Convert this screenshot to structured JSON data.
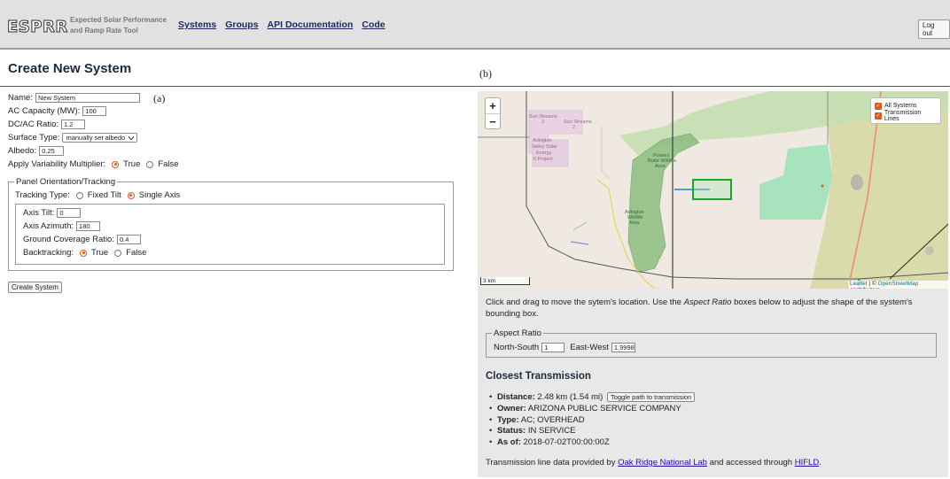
{
  "header": {
    "logo": "ESPRR",
    "tagline_line1": "Expected Solar Performance",
    "tagline_line2": "and Ramp Rate Tool",
    "nav": [
      "Systems",
      "Groups",
      "API Documentation",
      "Code"
    ],
    "logout": "Log out"
  },
  "page_title": "Create New System",
  "panel_labels": {
    "a": "(a)",
    "b": "(b)"
  },
  "form": {
    "name_label": "Name:",
    "name_value": "New System",
    "ac_label": "AC Capacity (MW):",
    "ac_value": "100",
    "dcac_label": "DC/AC Ratio:",
    "dcac_value": "1.2",
    "surface_label": "Surface Type:",
    "surface_value": "manually set albedo",
    "albedo_label": "Albedo:",
    "albedo_value": "0.25",
    "variability_label": "Apply Variability Multiplier:",
    "variability_true": "True",
    "variability_false": "False",
    "variability_selected": "True",
    "panel_legend": "Panel Orientation/Tracking",
    "tracking_label": "Tracking Type:",
    "tracking_fixed": "Fixed Tilt",
    "tracking_single": "Single Axis",
    "tracking_selected": "Single Axis",
    "axis_tilt_label": "Axis Tilt:",
    "axis_tilt_value": "0",
    "axis_azimuth_label": "Axis Azimuth:",
    "axis_azimuth_value": "180",
    "gcr_label": "Ground Coverage Ratio:",
    "gcr_value": "0.4",
    "backtracking_label": "Backtracking:",
    "backtracking_true": "True",
    "backtracking_false": "False",
    "backtracking_selected": "True",
    "create_button": "Create System"
  },
  "map": {
    "zoom_in": "+",
    "zoom_out": "−",
    "layers": [
      "All Systems",
      "Transmission Lines"
    ],
    "scale": "3 km",
    "attribution_leaflet": "Leaflet",
    "attribution_sep": " | © ",
    "attribution_osm": "OpenStreetMap",
    "attribution_tail": " contributors",
    "labels": {
      "sun_streams_3": [
        "Sun Streams",
        "3"
      ],
      "sun_streams_2": [
        "Sun Streams",
        "2"
      ],
      "arlington_valley": [
        "Arlington",
        "Valley Solar",
        "Energy",
        "II Project"
      ],
      "powers_butte": [
        "Powers",
        "Butte Wildlife",
        "Area"
      ],
      "arlington_wildlife": [
        "Arlington",
        "Wildlife",
        "Area"
      ]
    }
  },
  "instructions": {
    "part1": "Click and drag to move the sytem's location. Use the ",
    "italic": "Aspect Ratio",
    "part2": " boxes below to adjust the shape of the system's bounding box."
  },
  "aspect_ratio": {
    "legend": "Aspect Ratio",
    "ns_label": "North-South",
    "ns_value": "1",
    "ew_label": "East-West",
    "ew_value": "1.9998"
  },
  "closest_transmission": {
    "title": "Closest Transmission",
    "distance_label": "Distance:",
    "distance_value": "2.48 km (1.54 mi)",
    "toggle_button": "Toggle path to transmission",
    "owner_label": "Owner:",
    "owner_value": "ARIZONA PUBLIC SERVICE COMPANY",
    "type_label": "Type:",
    "type_value": "AC; OVERHEAD",
    "status_label": "Status:",
    "status_value": "IN SERVICE",
    "asof_label": "As of:",
    "asof_value": "2018-07-02T00:00:00Z"
  },
  "footer": {
    "prefix": "Transmission line data provided by ",
    "link1": "Oak Ridge National Lab",
    "middle": " and accessed through ",
    "link2": "HIFLD",
    "suffix": "."
  },
  "colors": {
    "accent": "#e05a1c",
    "nav_link": "#1a2a5e",
    "system_box": "#1aa82a",
    "path_line": "#2b7bd6"
  }
}
